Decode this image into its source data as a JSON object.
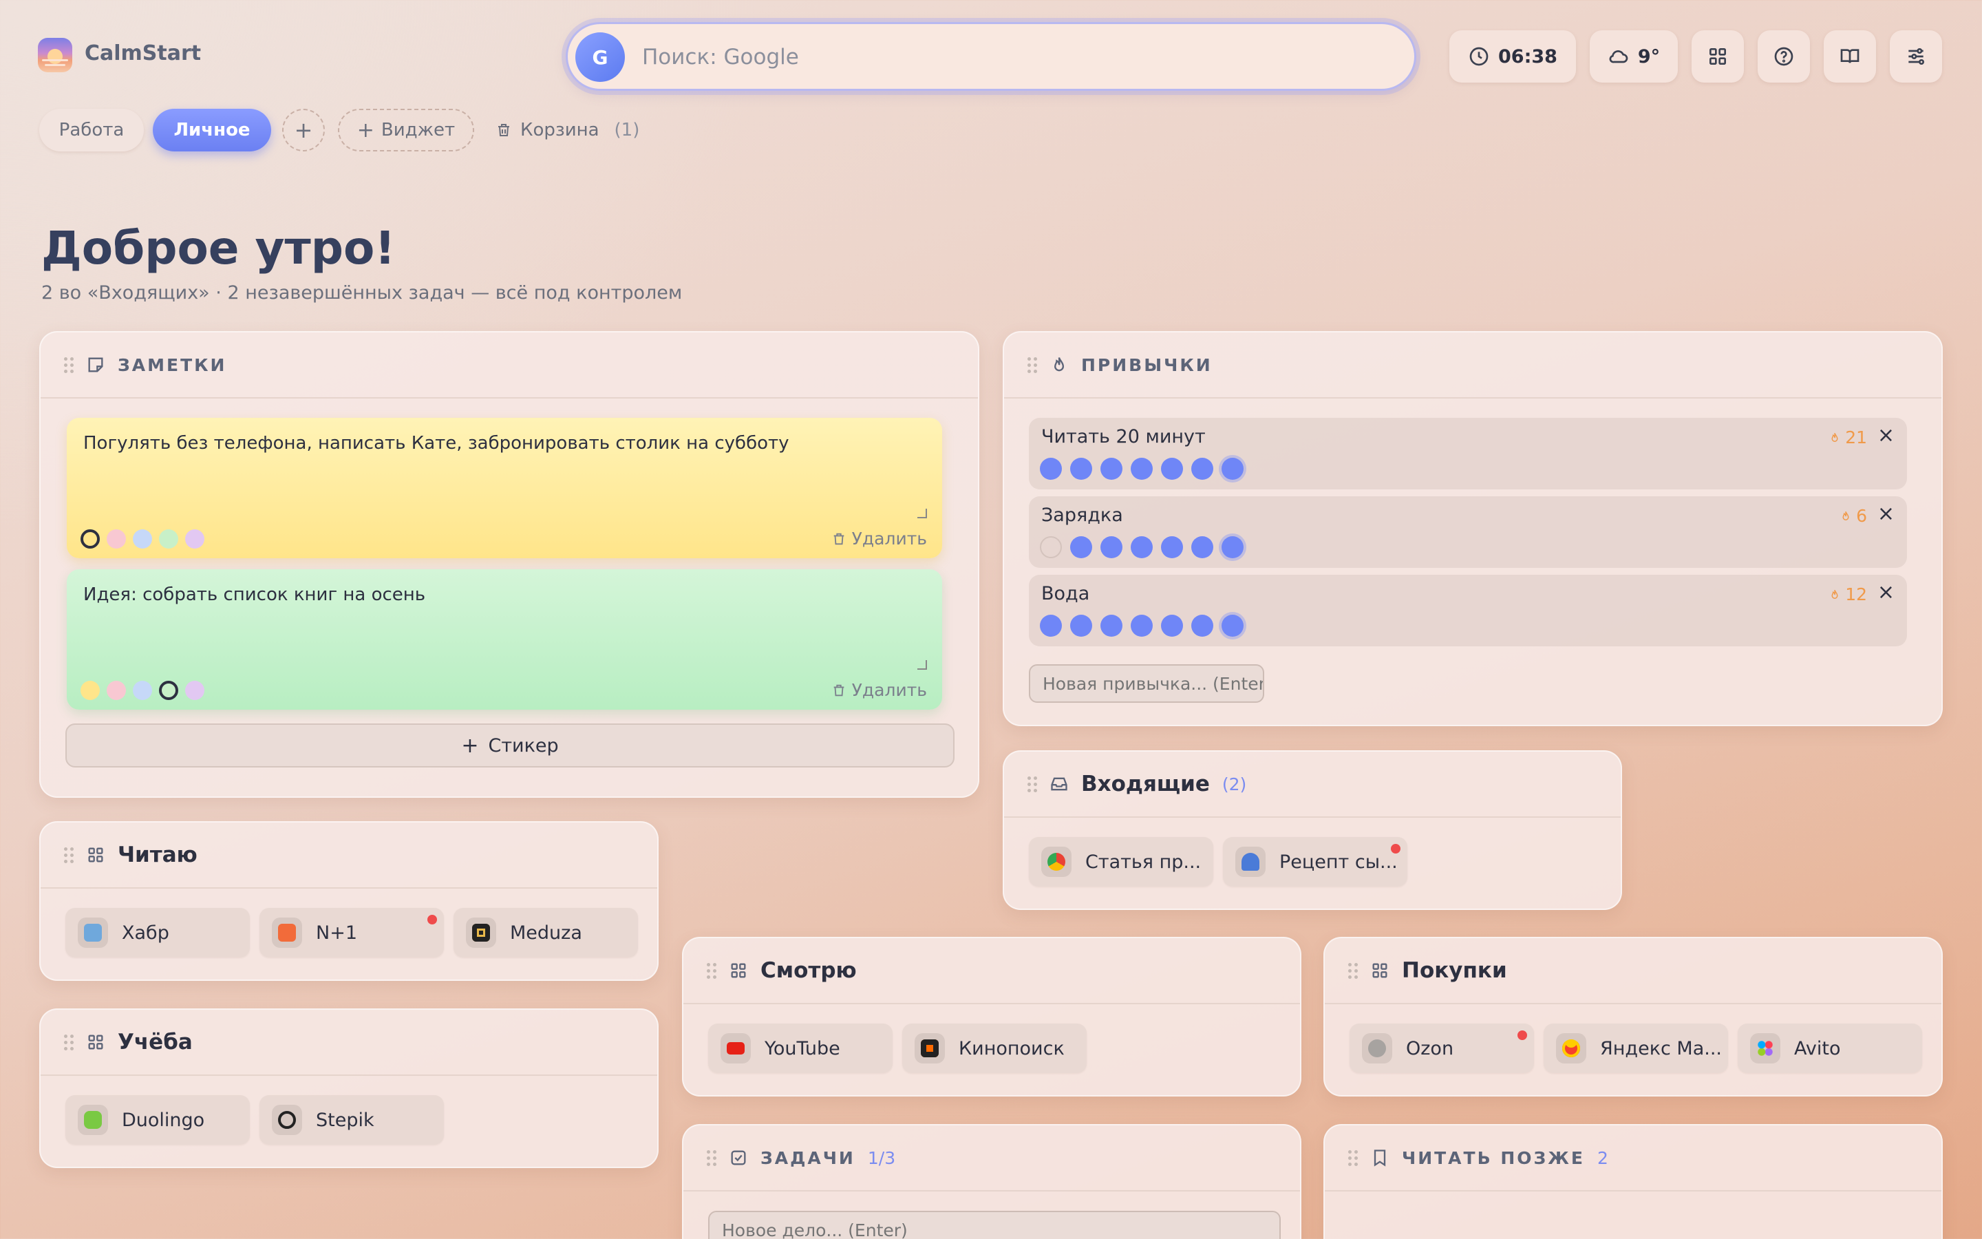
{
  "app": {
    "brand": "CalmStart"
  },
  "search": {
    "engine_letter": "G",
    "placeholder": "Поиск: Google"
  },
  "topbar": {
    "time": "06:38",
    "temperature": "9°"
  },
  "tabs": [
    {
      "label": "Работа",
      "active": false
    },
    {
      "label": "Личное",
      "active": true
    }
  ],
  "toolbar": {
    "add_tab": "+",
    "add_widget": "Виджет",
    "trash_label": "Корзина",
    "trash_count": "(1)"
  },
  "hero": {
    "title": "Доброе утро!",
    "subtitle": "2 во «Входящих» · 2 незавершённых задач — всё под контролем"
  },
  "notes": {
    "title": "ЗАМЕТКИ",
    "items": [
      {
        "text": "Погулять без телефона, написать Кате, забронировать столик на субботу",
        "color": "#ffe98f",
        "delete": "Удалить"
      },
      {
        "text": "Идея: собрать список книг на осень",
        "color": "#bff0c8",
        "delete": "Удалить"
      }
    ],
    "swatch_colors": [
      "#ffe58a",
      "#f8c8d2",
      "#c6d8f8",
      "#c8f0c8",
      "#e2c8f2"
    ],
    "add_sticker": "Стикер"
  },
  "habits": {
    "title": "ПРИВЫЧКИ",
    "items": [
      {
        "name": "Читать 20 минут",
        "streak": "21",
        "done": [
          1,
          1,
          1,
          1,
          1,
          1,
          1
        ]
      },
      {
        "name": "Зарядка",
        "streak": "6",
        "done": [
          0,
          1,
          1,
          1,
          1,
          1,
          1
        ]
      },
      {
        "name": "Вода",
        "streak": "12",
        "done": [
          1,
          1,
          1,
          1,
          1,
          1,
          1
        ]
      }
    ],
    "new_placeholder": "Новая привычка... (Enter)"
  },
  "inbox": {
    "title": "Входящие",
    "count": "(2)",
    "items": [
      {
        "label": "Статья пр...",
        "icon": "chrome-icon"
      },
      {
        "label": "Рецепт сы...",
        "icon": "recipe-icon",
        "badge": true
      }
    ]
  },
  "reading": {
    "title": "Читаю",
    "items": [
      {
        "label": "Хабр",
        "icon": "habr-icon"
      },
      {
        "label": "N+1",
        "icon": "nplus1-icon",
        "badge": true
      },
      {
        "label": "Meduza",
        "icon": "meduza-icon"
      }
    ]
  },
  "study": {
    "title": "Учёба",
    "items": [
      {
        "label": "Duolingo",
        "icon": "duolingo-icon"
      },
      {
        "label": "Stepik",
        "icon": "stepik-icon"
      }
    ]
  },
  "watching": {
    "title": "Смотрю",
    "items": [
      {
        "label": "YouTube",
        "icon": "youtube-icon"
      },
      {
        "label": "Кинопоиск",
        "icon": "kinopoisk-icon"
      }
    ]
  },
  "shopping": {
    "title": "Покупки",
    "items": [
      {
        "label": "Ozon",
        "icon": "ozon-icon",
        "badge": true
      },
      {
        "label": "Яндекс Ма...",
        "icon": "yandex-market-icon"
      },
      {
        "label": "Avito",
        "icon": "avito-icon"
      }
    ]
  },
  "tasks": {
    "title": "ЗАДАЧИ",
    "count": "1/3",
    "new_placeholder": "Новое дело... (Enter)"
  },
  "read_later": {
    "title": "ЧИТАТЬ ПОЗЖЕ",
    "count": "2"
  },
  "colors": {
    "accent": "#6f86f7",
    "streak": "#f09a4a",
    "badge": "#ef4b4b"
  }
}
